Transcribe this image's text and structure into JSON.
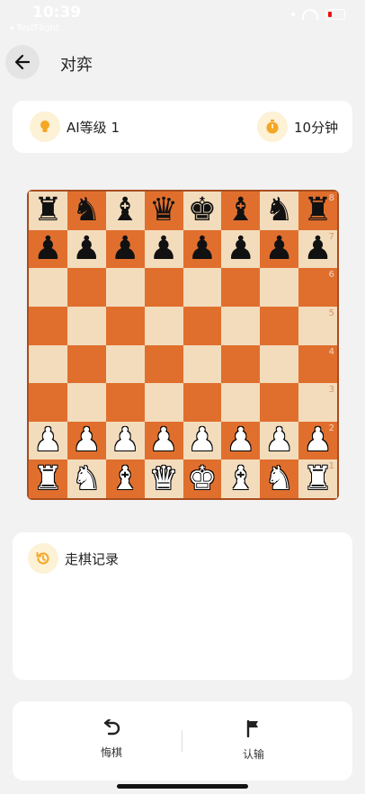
{
  "status_bar": {
    "time": "10:39",
    "carrier": "◂ TestFlight"
  },
  "header": {
    "title": "对弈"
  },
  "game_info": {
    "ai_level": "AI等级 1",
    "time_control": "10分钟"
  },
  "board": {
    "ranks": [
      "8",
      "7",
      "6",
      "5",
      "4",
      "3",
      "2",
      "1"
    ],
    "rows": [
      [
        "♜",
        "♞",
        "♝",
        "♛",
        "♚",
        "♝",
        "♞",
        "♜"
      ],
      [
        "♟",
        "♟",
        "♟",
        "♟",
        "♟",
        "♟",
        "♟",
        "♟"
      ],
      [
        "",
        "",
        "",
        "",
        "",
        "",
        "",
        ""
      ],
      [
        "",
        "",
        "",
        "",
        "",
        "",
        "",
        ""
      ],
      [
        "",
        "",
        "",
        "",
        "",
        "",
        "",
        ""
      ],
      [
        "",
        "",
        "",
        "",
        "",
        "",
        "",
        ""
      ],
      [
        "♟",
        "♟",
        "♟",
        "♟",
        "♟",
        "♟",
        "♟",
        "♟"
      ],
      [
        "♜",
        "♞",
        "♝",
        "♛",
        "♚",
        "♝",
        "♞",
        "♜"
      ]
    ],
    "colors": {
      "light": "#f3dcbc",
      "dark": "#e06f2e",
      "border": "#a84d1e"
    }
  },
  "history": {
    "title": "走棋记录"
  },
  "actions": {
    "undo_label": "悔棋",
    "resign_label": "认输"
  },
  "colors": {
    "accent": "#f5a623",
    "icon_bg": "#fdf1d6"
  }
}
